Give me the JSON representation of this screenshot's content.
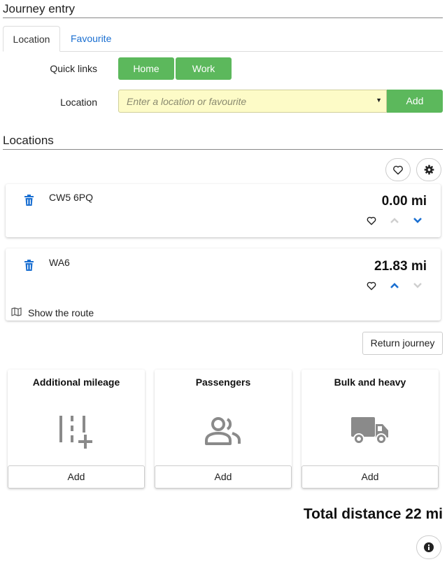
{
  "header": {
    "title": "Journey entry"
  },
  "tabs": [
    {
      "label": "Location"
    },
    {
      "label": "Favourite"
    }
  ],
  "quick_links": {
    "label": "Quick links",
    "buttons": [
      {
        "label": "Home"
      },
      {
        "label": "Work"
      }
    ]
  },
  "location_field": {
    "label": "Location",
    "placeholder": "Enter a location or favourite",
    "add_label": "Add"
  },
  "locations": {
    "title": "Locations",
    "items": [
      {
        "postcode": "CW5 6PQ",
        "distance": "0.00 mi"
      },
      {
        "postcode": "WA6",
        "distance": "21.83 mi",
        "route_label": "Show the route"
      }
    ]
  },
  "return_journey_label": "Return journey",
  "tiles": [
    {
      "title": "Additional mileage",
      "button": "Add",
      "icon": "additional-mileage-icon"
    },
    {
      "title": "Passengers",
      "button": "Add",
      "icon": "passengers-icon"
    },
    {
      "title": "Bulk and heavy",
      "button": "Add",
      "icon": "truck-icon"
    }
  ],
  "total_label": "Total distance 22 mi",
  "colors": {
    "accent_green": "#5cb85c",
    "link_blue": "#1a6fd1",
    "input_bg": "#fdfbc7"
  }
}
